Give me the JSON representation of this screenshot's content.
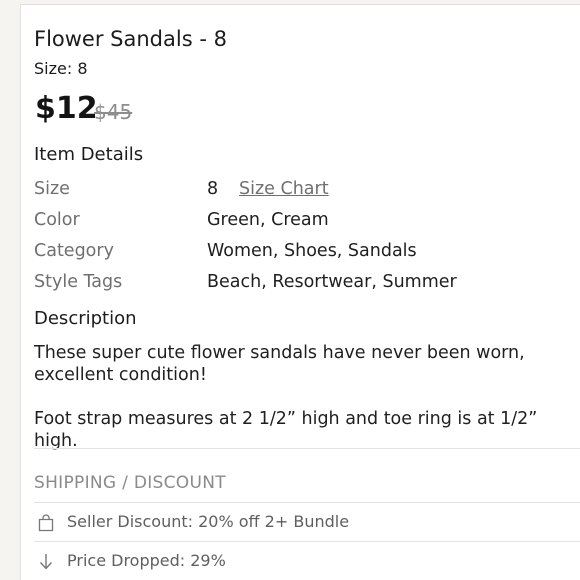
{
  "listing": {
    "title": "Flower Sandals - 8",
    "size_line": "Size: 8",
    "price": "$12",
    "original_price": "$45"
  },
  "item_details": {
    "heading": "Item Details",
    "rows": [
      {
        "label": "Size",
        "value": "8",
        "link": "Size Chart"
      },
      {
        "label": "Color",
        "value": "Green, Cream"
      },
      {
        "label": "Category",
        "value": "Women, Shoes, Sandals"
      },
      {
        "label": "Style Tags",
        "value": "Beach, Resortwear, Summer"
      }
    ]
  },
  "description": {
    "heading": "Description",
    "paragraphs": [
      "These super cute flower sandals have never been worn, excellent condition!",
      "Foot strap measures at 2 1/2” high and toe ring is at 1/2” high."
    ]
  },
  "shipping": {
    "heading": "SHIPPING / DISCOUNT",
    "items": [
      {
        "icon": "shopping-bag-icon",
        "text": "Seller Discount: 20% off 2+ Bundle"
      },
      {
        "icon": "arrow-down-icon",
        "text": "Price Dropped: 29%"
      }
    ]
  },
  "colors": {
    "background": "#f6f4f0",
    "text": "#1c1c1c",
    "muted_text": "#6f6f6f",
    "strikethrough": "#8d8d8d"
  }
}
